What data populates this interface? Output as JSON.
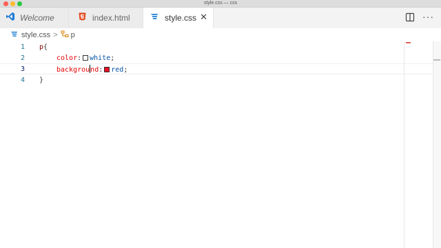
{
  "window": {
    "title": "style.css — css"
  },
  "tabs": [
    {
      "label": "Welcome"
    },
    {
      "label": "index.html"
    },
    {
      "label": "style.css"
    }
  ],
  "breadcrumb": {
    "file": "style.css",
    "separator": ">",
    "selector": "p"
  },
  "editor": {
    "lines": [
      {
        "number": "1"
      },
      {
        "number": "2"
      },
      {
        "number": "3"
      },
      {
        "number": "4"
      }
    ],
    "line1": {
      "selector": "p",
      "open": "{"
    },
    "line2": {
      "property": "color",
      "colon": ":",
      "value": "white",
      "semi": ";"
    },
    "line3": {
      "property_a": "backgrou",
      "property_b": "nd",
      "colon": ":",
      "value": "red",
      "semi": ";"
    },
    "line4": {
      "close": "}"
    }
  },
  "colors": {
    "white_swatch": "#ffffff",
    "red_swatch": "#e81123",
    "line_number": "#237893",
    "property": "#e50000",
    "value": "#0451a5"
  },
  "icons": {
    "welcome_tab": "vscode-logo-icon",
    "index_tab": "html5-icon",
    "style_tab": "css3-icon",
    "breadcrumb_selector": "symbol-class-icon",
    "split_editor": "split-editor-icon"
  }
}
